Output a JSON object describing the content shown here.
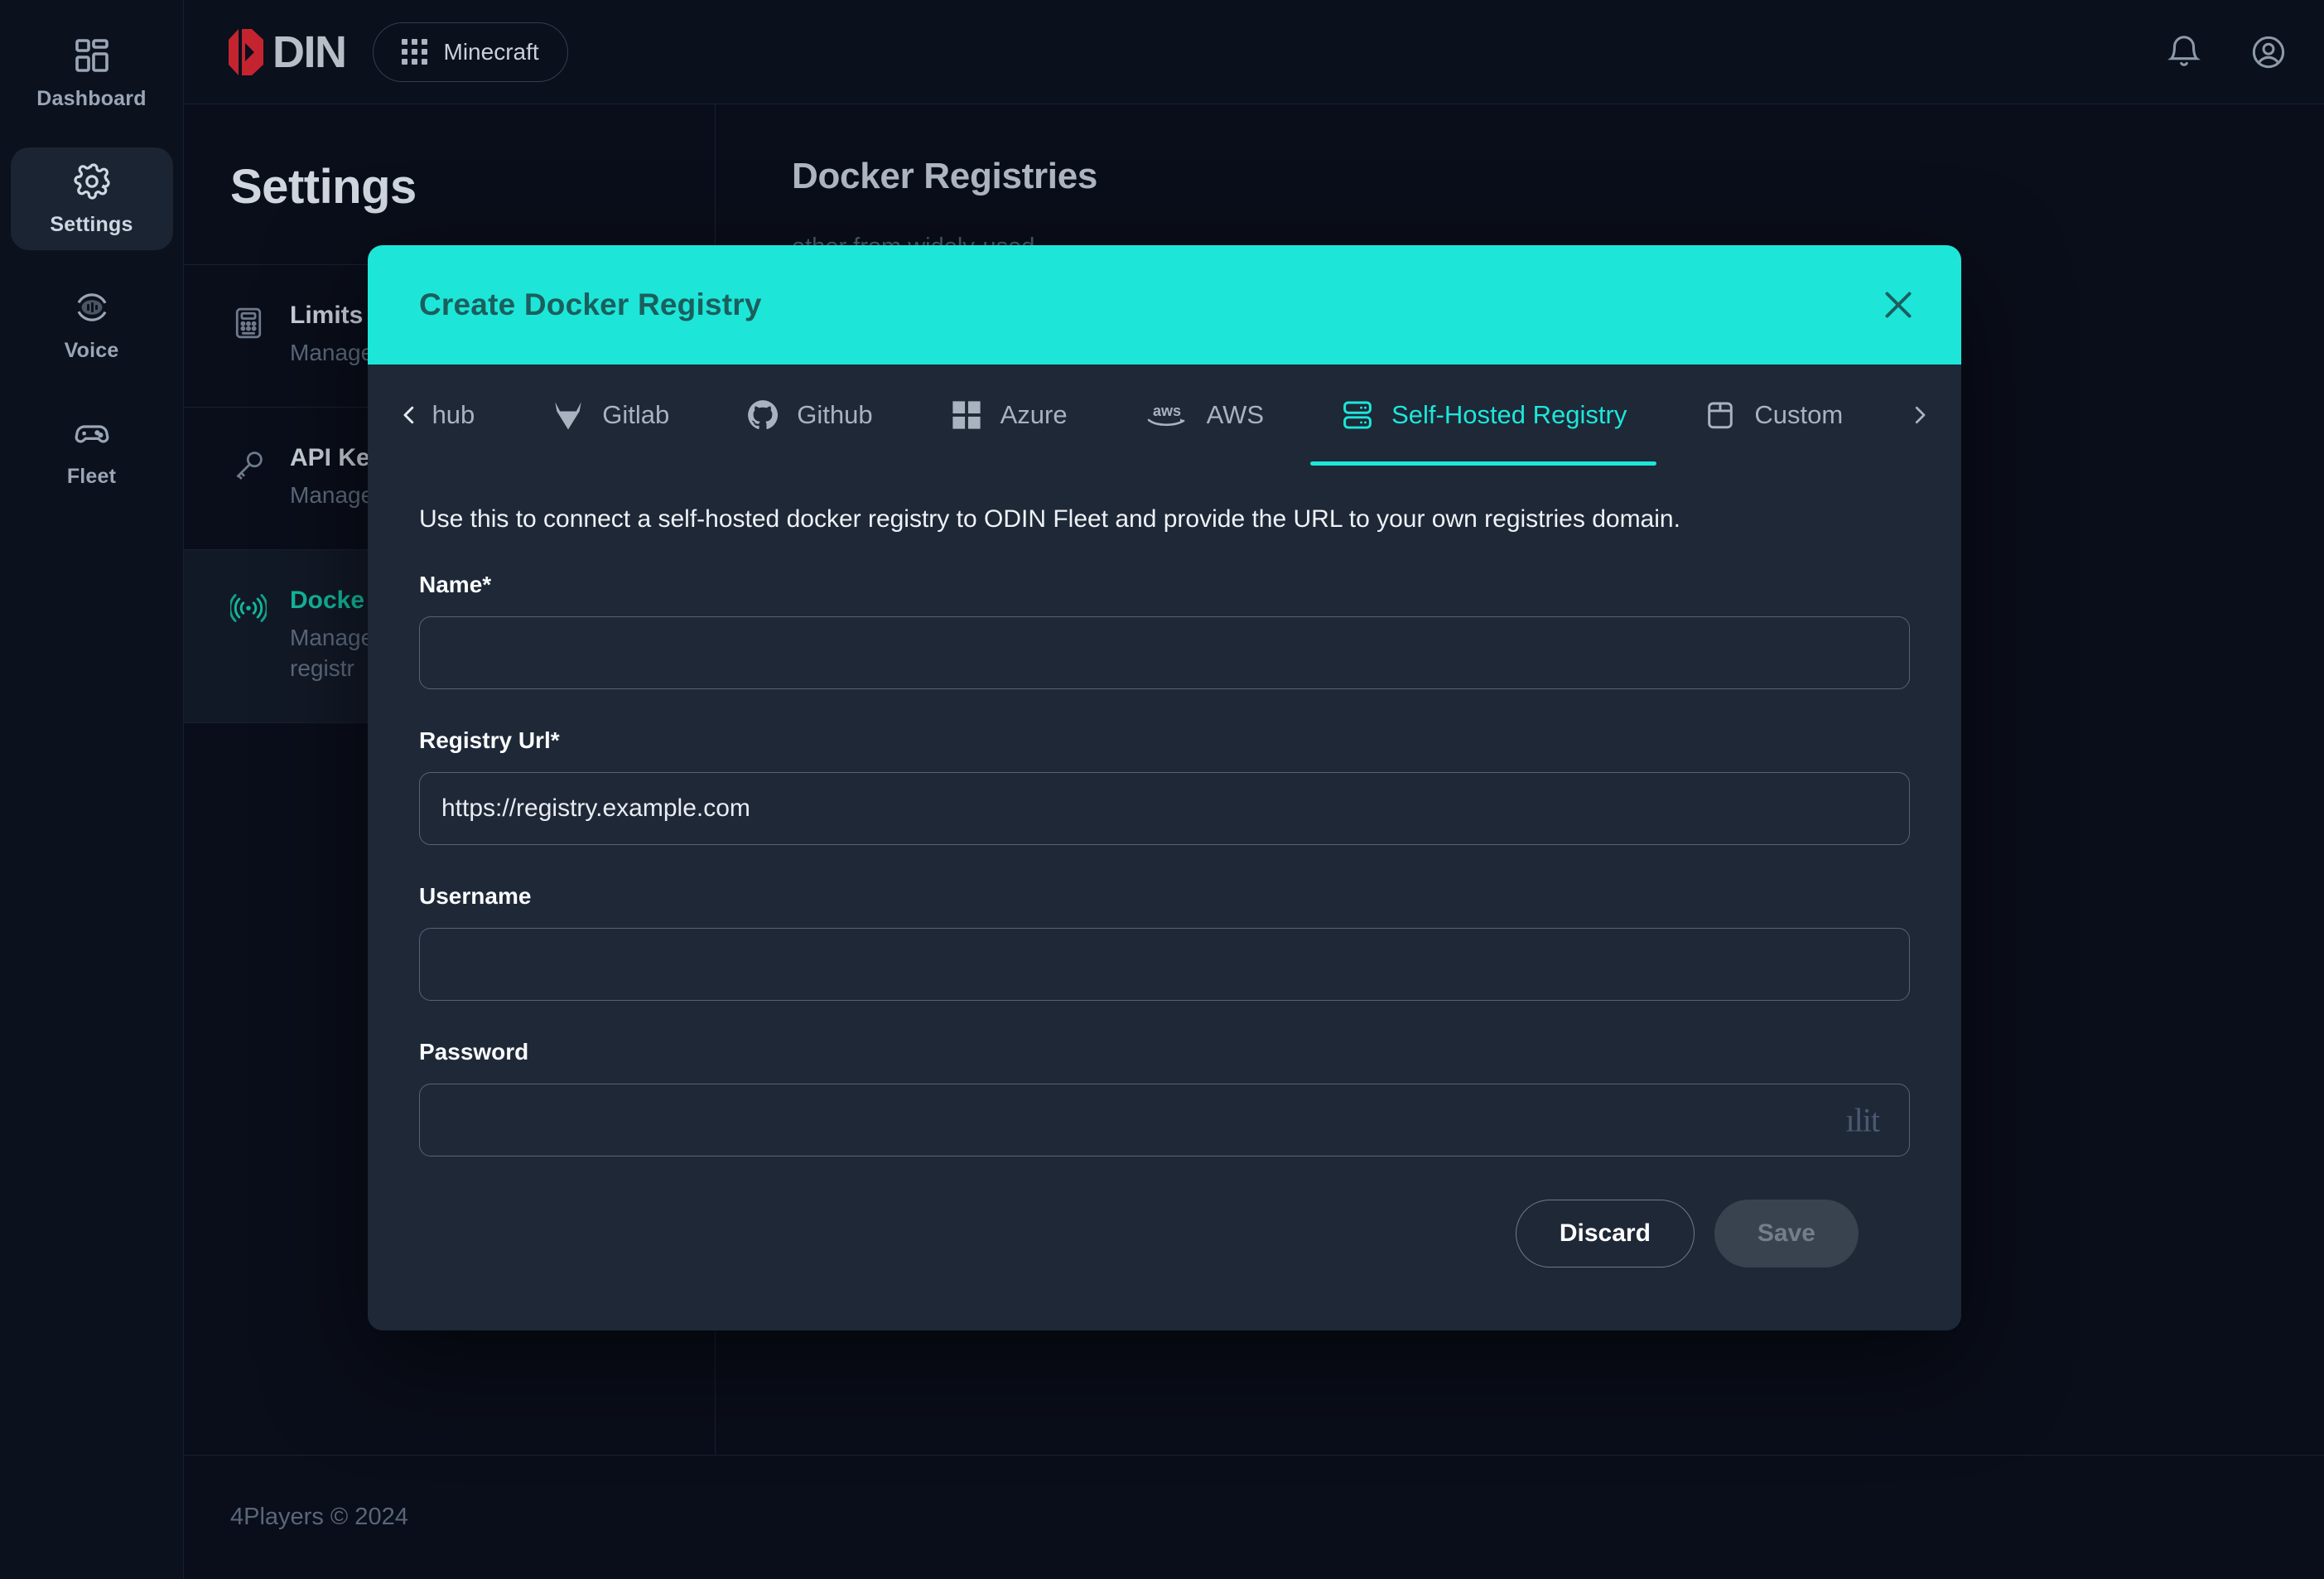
{
  "brand": {
    "word": "DIN",
    "mark_icon": "odin-logo-icon"
  },
  "topbar": {
    "project_label": "Minecraft",
    "grid_icon": "grid-9-dots-icon",
    "bell_icon": "bell-icon",
    "account_icon": "user-circle-icon"
  },
  "rail": {
    "items": [
      {
        "label": "Dashboard",
        "icon": "dashboard-icon",
        "active": false
      },
      {
        "label": "Settings",
        "icon": "gear-icon",
        "active": true
      },
      {
        "label": "Voice",
        "icon": "voice-icon",
        "active": false
      },
      {
        "label": "Fleet",
        "icon": "gamepad-icon",
        "active": false
      }
    ]
  },
  "settings": {
    "title": "Settings",
    "items": [
      {
        "name": "Limits",
        "desc": "Manage",
        "icon": "calculator-icon",
        "active": false
      },
      {
        "name": "API Ke",
        "desc": "Manage",
        "icon": "key-icon",
        "active": false
      },
      {
        "name": "Docke",
        "desc": "Manage\nregistr",
        "icon": "broadcast-icon",
        "active": true
      }
    ]
  },
  "main": {
    "title": "Docker Registries",
    "desc": "ether from widely-used\neds. Each registry entry in\nt and deployment"
  },
  "footer": {
    "copyright": "4Players © 2024"
  },
  "modal": {
    "title": "Create Docker Registry",
    "close_icon": "close-icon",
    "prev_arrow_icon": "chevron-left-icon",
    "next_arrow_icon": "chevron-right-icon",
    "tabs": [
      {
        "label": "erhub",
        "icon": "dockerhub-icon",
        "active": false,
        "clipped": true
      },
      {
        "label": "Gitlab",
        "icon": "gitlab-icon",
        "active": false
      },
      {
        "label": "Github",
        "icon": "github-icon",
        "active": false
      },
      {
        "label": "Azure",
        "icon": "azure-icon",
        "active": false
      },
      {
        "label": "AWS",
        "icon": "aws-icon",
        "active": false
      },
      {
        "label": "Self-Hosted Registry",
        "icon": "server-rack-icon",
        "active": true
      },
      {
        "label": "Custom",
        "icon": "box-icon",
        "active": false
      }
    ],
    "hint": "Use this to connect a self-hosted docker registry to ODIN Fleet and provide the URL to your own registries domain.",
    "fields": {
      "name": {
        "label": "Name*",
        "value": "",
        "placeholder": ""
      },
      "registry_url": {
        "label": "Registry Url*",
        "value": "https://registry.example.com",
        "placeholder": ""
      },
      "username": {
        "label": "Username",
        "value": "",
        "placeholder": ""
      },
      "password": {
        "label": "Password",
        "value": "",
        "placeholder": "",
        "overlay_glyph": "ılit"
      }
    },
    "buttons": {
      "discard": "Discard",
      "save": "Save"
    }
  },
  "colors": {
    "accent_teal": "#1de6d9",
    "brand_red": "#c32430",
    "page_bg": "#0a0e1a",
    "modal_bg": "#1e2837",
    "active_green": "#13b89c"
  }
}
